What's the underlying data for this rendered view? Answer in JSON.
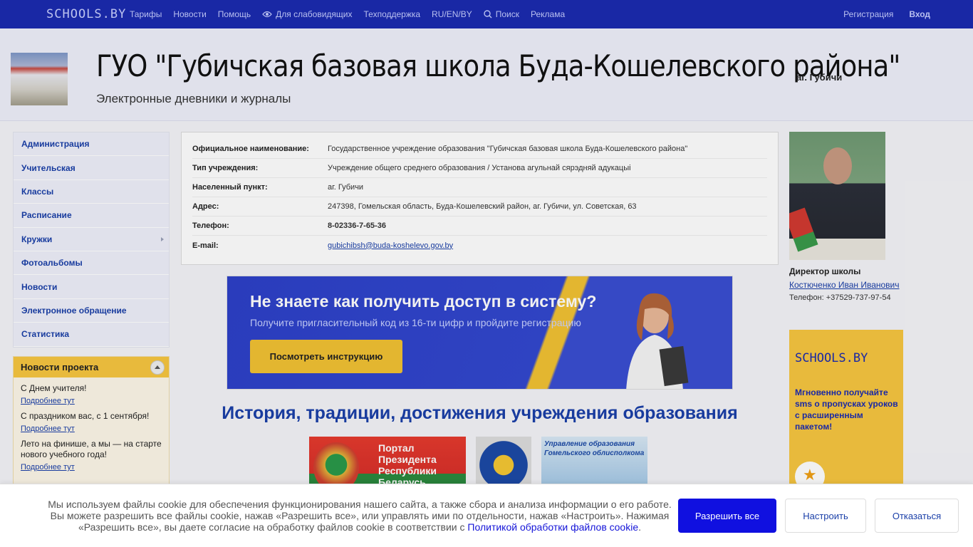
{
  "topbar": {
    "logo": "SCHOOLS.BY",
    "nav": [
      "Тарифы",
      "Новости",
      "Помощь",
      "Для слабовидящих",
      "Техподдержка",
      "RU/EN/BY",
      "Поиск",
      "Реклама"
    ],
    "register": "Регистрация",
    "login": "Вход"
  },
  "header": {
    "title": "ГУО \"Губичская базовая школа Буда-Кошелевского района\"",
    "location": "аг. Губичи",
    "subtitle": "Электронные дневники и журналы"
  },
  "sidebar": {
    "items": [
      "Администрация",
      "Учительская",
      "Классы",
      "Расписание",
      "Кружки",
      "Фотоальбомы",
      "Новости",
      "Электронное обращение",
      "Статистика"
    ]
  },
  "project_news": {
    "title": "Новости проекта",
    "items": [
      {
        "text": "С Днем учителя!",
        "more": "Подробнее тут"
      },
      {
        "text": "С праздником вас, с 1 сентября!",
        "more": "Подробнее тут"
      },
      {
        "text": "Лето на финише, а мы — на старте нового учебного года!",
        "more": "Подробнее тут"
      }
    ]
  },
  "info": {
    "rows": [
      {
        "label": "Официальное наименование:",
        "value": "Государственное учреждение образования \"Губичская базовая школа Буда-Кошелевского района\""
      },
      {
        "label": "Тип учреждения:",
        "value": "Учреждение общего среднего образования / Установа агульнай сярэдняй адукацыі"
      },
      {
        "label": "Населенный пункт:",
        "value": "аг. Губичи"
      },
      {
        "label": "Адрес:",
        "value": "247398, Гомельская область, Буда-Кошелевский район, аг. Губичи, ул. Советская, 63"
      },
      {
        "label": "Телефон:",
        "value": "8-02336-7-65-36"
      },
      {
        "label": "E-mail:",
        "value": "gubichibsh@buda-koshelevo.gov.by"
      }
    ]
  },
  "banner": {
    "heading": "Не знаете как получить доступ в систему?",
    "sub": "Получите пригласительный код из 16-ти цифр и пройдите регистрацию",
    "button": "Посмотреть инструкцию"
  },
  "history_title": "История, традиции, достижения учреждения образования",
  "logos": {
    "portal": "Портал Президента Республики Беларусь",
    "education": "Управление образования Гомельского облисполкома"
  },
  "director": {
    "title": "Директор школы",
    "name": "Костюченко Иван Иванович",
    "phone": "Телефон: +37529-737-97-54"
  },
  "ad": {
    "brand": "SCHOOLS.BY",
    "text": "Мгновенно получайте sms о пропусках уроков с расширенным пакетом!"
  },
  "cookie": {
    "text": "Мы используем файлы cookie для обеспечения функционирования нашего сайта, а также сбора и анализа информации о его работе. Вы можете разрешить все файлы cookie, нажав «Разрешить все», или управлять ими по отдельности, нажав «Настроить». Нажимая «Разрешить все», вы даете согласие на обработку файлов cookie в соответствии с",
    "link": "Политикой обработки файлов cookie",
    "allow": "Разрешить все",
    "configure": "Настроить",
    "decline": "Отказаться"
  },
  "colors": {
    "topbar": "#1b2bb0",
    "link": "#1a3fa8",
    "accent_yellow": "#f7c640",
    "cookie_primary": "#1010e0"
  }
}
